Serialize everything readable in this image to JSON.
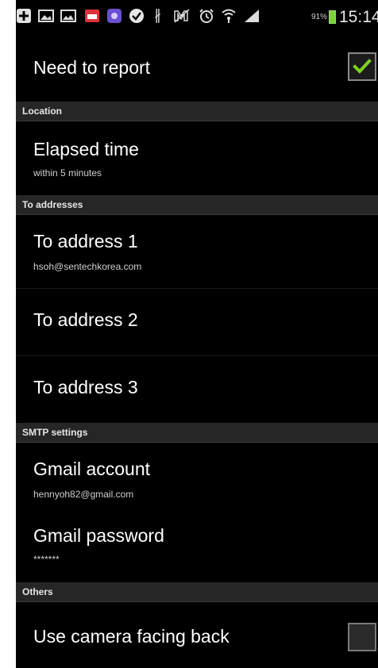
{
  "status_bar": {
    "icons": [
      "add-icon",
      "image-icon",
      "gallery-icon",
      "calendar-icon",
      "app-icon",
      "checkmark-icon",
      "bluetooth-icon",
      "mute-icon",
      "alarm-icon",
      "wifi-icon",
      "signal-icon"
    ],
    "battery_percent": "91%",
    "time": "15:14"
  },
  "preferences": {
    "need_to_report": {
      "title": "Need to report",
      "checked": true
    },
    "sections": {
      "location": "Location",
      "to_addresses": "To addresses",
      "smtp": "SMTP settings",
      "others": "Others"
    },
    "elapsed_time": {
      "title": "Elapsed time",
      "summary": "within 5 minutes"
    },
    "to_address_1": {
      "title": "To address 1",
      "summary": "hsoh@sentechkorea.com"
    },
    "to_address_2": {
      "title": "To address 2"
    },
    "to_address_3": {
      "title": "To address 3"
    },
    "gmail_account": {
      "title": "Gmail account",
      "summary": "hennyoh82@gmail.com"
    },
    "gmail_password": {
      "title": "Gmail password",
      "summary": "*******"
    },
    "use_camera_back": {
      "title": "Use camera facing back",
      "checked": false
    }
  },
  "colors": {
    "background": "#000000",
    "section_header": "#262626",
    "check_accent": "#7ed320",
    "battery": "#79d23a"
  }
}
